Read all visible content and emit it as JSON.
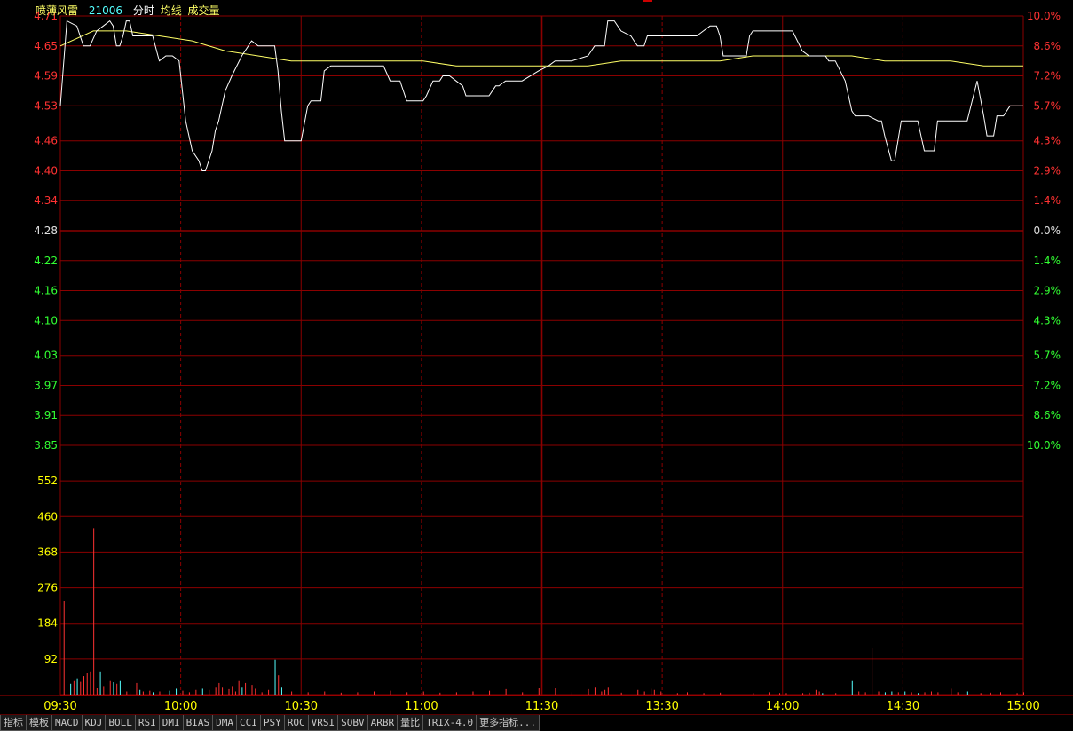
{
  "header": {
    "stock_name": "喷薄风雷",
    "code": "21006",
    "label_time": "分时",
    "label_avg": "均线",
    "label_volume": "成交量"
  },
  "colors": {
    "up": "#ff3232",
    "down": "#32ff32",
    "flat": "#e0e0e0",
    "grid": "#8b0000",
    "price_line": "#ffffff",
    "avg_line": "#ffff66",
    "vol_axis": "#ffff00",
    "vol_down": "#54ffff",
    "time_label": "#ffff00"
  },
  "chart_data": {
    "type": "line",
    "price_axis": {
      "prev_close": 4.28,
      "labels": [
        "4.71",
        "4.65",
        "4.59",
        "4.53",
        "4.46",
        "4.40",
        "4.34",
        "4.28",
        "4.22",
        "4.16",
        "4.10",
        "4.03",
        "3.97",
        "3.91",
        "3.85"
      ],
      "pct_labels": [
        "10.0%",
        "8.6%",
        "7.2%",
        "5.7%",
        "4.3%",
        "2.9%",
        "1.4%",
        "0.0%",
        "1.4%",
        "2.9%",
        "4.3%",
        "5.7%",
        "7.2%",
        "8.6%",
        "10.0%"
      ],
      "ylim": [
        3.85,
        4.71
      ]
    },
    "volume_axis": {
      "labels": [
        "552",
        "460",
        "368",
        "276",
        "184",
        "92"
      ],
      "ylim": [
        0,
        644
      ]
    },
    "time_labels": [
      "09:30",
      "10:00",
      "10:30",
      "11:00",
      "11:30",
      "13:30",
      "14:00",
      "14:30",
      "15:00"
    ],
    "price": [
      [
        0,
        4.53
      ],
      [
        2,
        4.7
      ],
      [
        5,
        4.69
      ],
      [
        7,
        4.65
      ],
      [
        9,
        4.65
      ],
      [
        11,
        4.68
      ],
      [
        13,
        4.69
      ],
      [
        15,
        4.7
      ],
      [
        16,
        4.69
      ],
      [
        17,
        4.65
      ],
      [
        18,
        4.65
      ],
      [
        19,
        4.67
      ],
      [
        20,
        4.7
      ],
      [
        21,
        4.7
      ],
      [
        22,
        4.67
      ],
      [
        24,
        4.67
      ],
      [
        28,
        4.67
      ],
      [
        30,
        4.62
      ],
      [
        32,
        4.63
      ],
      [
        34,
        4.63
      ],
      [
        36,
        4.62
      ],
      [
        37,
        4.56
      ],
      [
        38,
        4.5
      ],
      [
        40,
        4.44
      ],
      [
        42,
        4.42
      ],
      [
        43,
        4.4
      ],
      [
        44,
        4.4
      ],
      [
        46,
        4.44
      ],
      [
        47,
        4.48
      ],
      [
        48,
        4.5
      ],
      [
        50,
        4.56
      ],
      [
        52,
        4.59
      ],
      [
        55,
        4.63
      ],
      [
        57,
        4.65
      ],
      [
        58,
        4.66
      ],
      [
        60,
        4.65
      ],
      [
        62,
        4.65
      ],
      [
        64,
        4.65
      ],
      [
        65,
        4.65
      ],
      [
        66,
        4.6
      ],
      [
        67,
        4.52
      ],
      [
        68,
        4.46
      ],
      [
        70,
        4.46
      ],
      [
        71,
        4.46
      ],
      [
        72,
        4.46
      ],
      [
        73,
        4.46
      ],
      [
        75,
        4.53
      ],
      [
        76,
        4.54
      ],
      [
        79,
        4.54
      ],
      [
        80,
        4.6
      ],
      [
        82,
        4.61
      ],
      [
        85,
        4.61
      ],
      [
        90,
        4.61
      ],
      [
        95,
        4.61
      ],
      [
        98,
        4.61
      ],
      [
        100,
        4.58
      ],
      [
        102,
        4.58
      ],
      [
        103,
        4.58
      ],
      [
        105,
        4.54
      ],
      [
        110,
        4.54
      ],
      [
        111,
        4.55
      ],
      [
        113,
        4.58
      ],
      [
        115,
        4.58
      ],
      [
        116,
        4.59
      ],
      [
        118,
        4.59
      ],
      [
        120,
        4.58
      ],
      [
        122,
        4.57
      ],
      [
        123,
        4.55
      ],
      [
        125,
        4.55
      ],
      [
        128,
        4.55
      ],
      [
        130,
        4.55
      ],
      [
        132,
        4.57
      ],
      [
        133,
        4.57
      ],
      [
        135,
        4.58
      ],
      [
        137,
        4.58
      ],
      [
        140,
        4.58
      ],
      [
        145,
        4.6
      ],
      [
        148,
        4.61
      ],
      [
        150,
        4.62
      ],
      [
        155,
        4.62
      ],
      [
        160,
        4.63
      ],
      [
        162,
        4.65
      ],
      [
        165,
        4.65
      ],
      [
        166,
        4.7
      ],
      [
        168,
        4.7
      ],
      [
        170,
        4.68
      ],
      [
        173,
        4.67
      ],
      [
        174,
        4.66
      ],
      [
        175,
        4.65
      ],
      [
        176,
        4.65
      ],
      [
        177,
        4.65
      ],
      [
        178,
        4.67
      ],
      [
        180,
        4.67
      ],
      [
        185,
        4.67
      ],
      [
        190,
        4.67
      ],
      [
        193,
        4.67
      ],
      [
        195,
        4.68
      ],
      [
        197,
        4.69
      ],
      [
        199,
        4.69
      ],
      [
        200,
        4.67
      ],
      [
        201,
        4.63
      ],
      [
        205,
        4.63
      ],
      [
        208,
        4.63
      ],
      [
        209,
        4.67
      ],
      [
        210,
        4.68
      ],
      [
        215,
        4.68
      ],
      [
        220,
        4.68
      ],
      [
        222,
        4.68
      ],
      [
        225,
        4.64
      ],
      [
        227,
        4.63
      ],
      [
        229,
        4.63
      ],
      [
        232,
        4.63
      ],
      [
        233,
        4.62
      ],
      [
        235,
        4.62
      ],
      [
        238,
        4.58
      ],
      [
        240,
        4.52
      ],
      [
        241,
        4.51
      ],
      [
        245,
        4.51
      ],
      [
        248,
        4.5
      ],
      [
        249,
        4.5
      ],
      [
        250,
        4.47
      ],
      [
        252,
        4.42
      ],
      [
        253,
        4.42
      ],
      [
        255,
        4.5
      ],
      [
        258,
        4.5
      ],
      [
        260,
        4.5
      ],
      [
        262,
        4.44
      ],
      [
        263,
        4.44
      ],
      [
        265,
        4.44
      ],
      [
        266,
        4.5
      ],
      [
        268,
        4.5
      ],
      [
        270,
        4.5
      ],
      [
        275,
        4.5
      ],
      [
        278,
        4.58
      ],
      [
        280,
        4.51
      ],
      [
        281,
        4.47
      ],
      [
        283,
        4.47
      ],
      [
        284,
        4.51
      ],
      [
        286,
        4.51
      ],
      [
        288,
        4.53
      ],
      [
        290,
        4.53
      ],
      [
        292,
        4.53
      ]
    ],
    "avg": [
      [
        0,
        4.65
      ],
      [
        10,
        4.68
      ],
      [
        20,
        4.68
      ],
      [
        30,
        4.67
      ],
      [
        40,
        4.66
      ],
      [
        50,
        4.64
      ],
      [
        60,
        4.63
      ],
      [
        70,
        4.62
      ],
      [
        80,
        4.62
      ],
      [
        90,
        4.62
      ],
      [
        100,
        4.62
      ],
      [
        110,
        4.62
      ],
      [
        120,
        4.61
      ],
      [
        130,
        4.61
      ],
      [
        140,
        4.61
      ],
      [
        150,
        4.61
      ],
      [
        160,
        4.61
      ],
      [
        170,
        4.62
      ],
      [
        180,
        4.62
      ],
      [
        190,
        4.62
      ],
      [
        200,
        4.62
      ],
      [
        210,
        4.63
      ],
      [
        220,
        4.63
      ],
      [
        230,
        4.63
      ],
      [
        240,
        4.63
      ],
      [
        250,
        4.62
      ],
      [
        260,
        4.62
      ],
      [
        270,
        4.62
      ],
      [
        280,
        4.61
      ],
      [
        292,
        4.61
      ]
    ],
    "volume": [
      [
        1,
        242,
        "u"
      ],
      [
        3,
        28,
        "d"
      ],
      [
        4,
        35,
        "u"
      ],
      [
        5,
        42,
        "d"
      ],
      [
        6,
        33,
        "u"
      ],
      [
        7,
        48,
        "u"
      ],
      [
        8,
        55,
        "u"
      ],
      [
        9,
        60,
        "u"
      ],
      [
        10,
        430,
        "u"
      ],
      [
        11,
        18,
        "u"
      ],
      [
        12,
        60,
        "d"
      ],
      [
        13,
        22,
        "u"
      ],
      [
        14,
        30,
        "u"
      ],
      [
        15,
        35,
        "u"
      ],
      [
        16,
        32,
        "d"
      ],
      [
        17,
        28,
        "u"
      ],
      [
        18,
        35,
        "d"
      ],
      [
        20,
        8,
        "u"
      ],
      [
        21,
        6,
        "u"
      ],
      [
        23,
        30,
        "u"
      ],
      [
        24,
        12,
        "d"
      ],
      [
        25,
        8,
        "u"
      ],
      [
        27,
        10,
        "u"
      ],
      [
        28,
        6,
        "d"
      ],
      [
        30,
        8,
        "u"
      ],
      [
        33,
        10,
        "d"
      ],
      [
        35,
        15,
        "d"
      ],
      [
        37,
        10,
        "u"
      ],
      [
        39,
        6,
        "u"
      ],
      [
        41,
        12,
        "u"
      ],
      [
        43,
        15,
        "d"
      ],
      [
        45,
        12,
        "u"
      ],
      [
        47,
        20,
        "u"
      ],
      [
        48,
        30,
        "u"
      ],
      [
        49,
        20,
        "u"
      ],
      [
        51,
        14,
        "u"
      ],
      [
        52,
        22,
        "u"
      ],
      [
        53,
        8,
        "u"
      ],
      [
        54,
        35,
        "u"
      ],
      [
        55,
        20,
        "d"
      ],
      [
        56,
        30,
        "u"
      ],
      [
        58,
        25,
        "u"
      ],
      [
        59,
        15,
        "u"
      ],
      [
        61,
        6,
        "u"
      ],
      [
        63,
        12,
        "u"
      ],
      [
        65,
        90,
        "d"
      ],
      [
        66,
        50,
        "u"
      ],
      [
        67,
        20,
        "d"
      ],
      [
        70,
        8,
        "u"
      ],
      [
        75,
        6,
        "u"
      ],
      [
        80,
        8,
        "u"
      ],
      [
        85,
        5,
        "u"
      ],
      [
        90,
        6,
        "u"
      ],
      [
        95,
        8,
        "u"
      ],
      [
        100,
        10,
        "u"
      ],
      [
        105,
        6,
        "u"
      ],
      [
        110,
        8,
        "u"
      ],
      [
        115,
        5,
        "u"
      ],
      [
        120,
        6,
        "u"
      ],
      [
        125,
        8,
        "u"
      ],
      [
        130,
        10,
        "u"
      ],
      [
        135,
        14,
        "u"
      ],
      [
        140,
        6,
        "u"
      ],
      [
        145,
        18,
        "u"
      ],
      [
        150,
        16,
        "u"
      ],
      [
        155,
        6,
        "u"
      ],
      [
        160,
        14,
        "u"
      ],
      [
        162,
        20,
        "u"
      ],
      [
        164,
        8,
        "u"
      ],
      [
        165,
        12,
        "u"
      ],
      [
        166,
        20,
        "u"
      ],
      [
        170,
        5,
        "u"
      ],
      [
        175,
        12,
        "u"
      ],
      [
        177,
        8,
        "u"
      ],
      [
        179,
        15,
        "u"
      ],
      [
        180,
        12,
        "u"
      ],
      [
        182,
        8,
        "u"
      ],
      [
        187,
        4,
        "u"
      ],
      [
        190,
        6,
        "u"
      ],
      [
        195,
        4,
        "u"
      ],
      [
        200,
        5,
        "u"
      ],
      [
        210,
        4,
        "u"
      ],
      [
        215,
        6,
        "u"
      ],
      [
        218,
        4,
        "u"
      ],
      [
        220,
        4,
        "u"
      ],
      [
        225,
        4,
        "u"
      ],
      [
        227,
        5,
        "u"
      ],
      [
        229,
        12,
        "u"
      ],
      [
        230,
        8,
        "u"
      ],
      [
        231,
        4,
        "d"
      ],
      [
        235,
        4,
        "u"
      ],
      [
        240,
        35,
        "d"
      ],
      [
        242,
        8,
        "u"
      ],
      [
        244,
        6,
        "u"
      ],
      [
        246,
        120,
        "u"
      ],
      [
        248,
        8,
        "u"
      ],
      [
        250,
        6,
        "d"
      ],
      [
        252,
        8,
        "d"
      ],
      [
        254,
        6,
        "u"
      ],
      [
        256,
        8,
        "d"
      ],
      [
        258,
        6,
        "u"
      ],
      [
        260,
        4,
        "d"
      ],
      [
        262,
        6,
        "u"
      ],
      [
        264,
        8,
        "u"
      ],
      [
        266,
        6,
        "u"
      ],
      [
        270,
        15,
        "u"
      ],
      [
        272,
        6,
        "u"
      ],
      [
        275,
        8,
        "d"
      ],
      [
        279,
        4,
        "u"
      ],
      [
        282,
        5,
        "u"
      ],
      [
        285,
        6,
        "u"
      ],
      [
        290,
        4,
        "u"
      ],
      [
        292,
        6,
        "u"
      ]
    ]
  },
  "toolbar": {
    "tabs": [
      "指标",
      "模板",
      "MACD",
      "KDJ",
      "BOLL",
      "RSI",
      "DMI",
      "BIAS",
      "DMA",
      "CCI",
      "PSY",
      "ROC",
      "VRSI",
      "SOBV",
      "ARBR",
      "量比",
      "TRIX-4.0",
      "更多指标..."
    ]
  }
}
